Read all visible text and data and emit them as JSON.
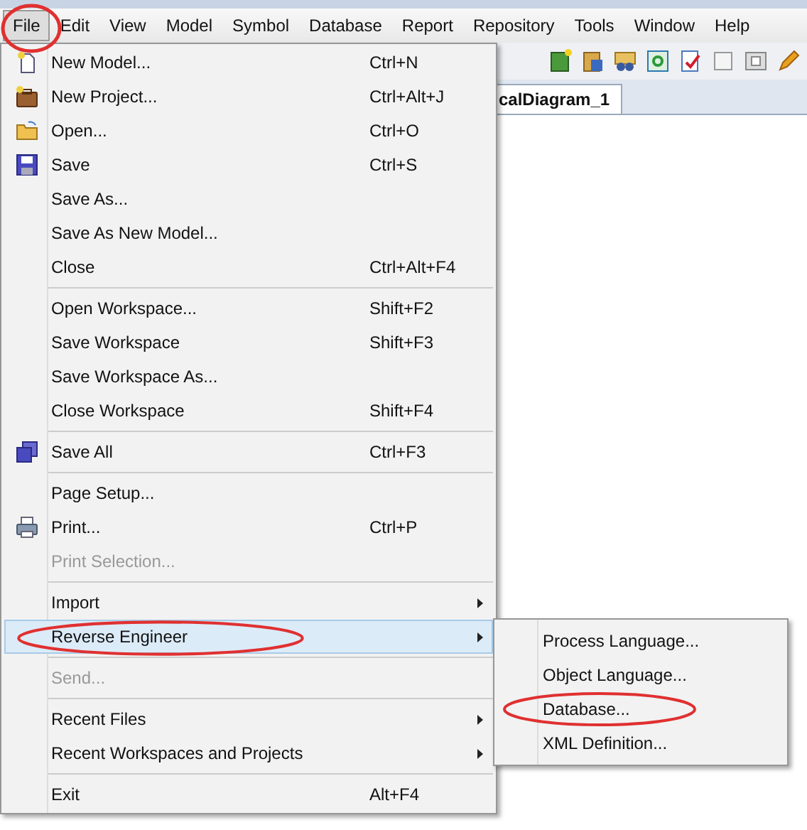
{
  "menubar": [
    {
      "label": "File",
      "selected": true
    },
    {
      "label": "Edit",
      "selected": false
    },
    {
      "label": "View",
      "selected": false
    },
    {
      "label": "Model",
      "selected": false
    },
    {
      "label": "Symbol",
      "selected": false
    },
    {
      "label": "Database",
      "selected": false
    },
    {
      "label": "Report",
      "selected": false
    },
    {
      "label": "Repository",
      "selected": false
    },
    {
      "label": "Tools",
      "selected": false
    },
    {
      "label": "Window",
      "selected": false
    },
    {
      "label": "Help",
      "selected": false
    }
  ],
  "document_tab": {
    "label": "calDiagram_1"
  },
  "file_menu": [
    {
      "kind": "item",
      "label": "New Model...",
      "shortcut": "Ctrl+N",
      "disabled": false,
      "submenu": false,
      "selected": false
    },
    {
      "kind": "item",
      "label": "New Project...",
      "shortcut": "Ctrl+Alt+J",
      "disabled": false,
      "submenu": false,
      "selected": false
    },
    {
      "kind": "item",
      "label": "Open...",
      "shortcut": "Ctrl+O",
      "disabled": false,
      "submenu": false,
      "selected": false
    },
    {
      "kind": "item",
      "label": "Save",
      "shortcut": "Ctrl+S",
      "disabled": false,
      "submenu": false,
      "selected": false
    },
    {
      "kind": "item",
      "label": "Save As...",
      "disabled": false,
      "submenu": false,
      "selected": false
    },
    {
      "kind": "item",
      "label": "Save As New Model...",
      "disabled": false,
      "submenu": false,
      "selected": false
    },
    {
      "kind": "item",
      "label": "Close",
      "shortcut": "Ctrl+Alt+F4",
      "disabled": false,
      "submenu": false,
      "selected": false
    },
    {
      "kind": "separator"
    },
    {
      "kind": "item",
      "label": "Open Workspace...",
      "shortcut": "Shift+F2",
      "disabled": false,
      "submenu": false,
      "selected": false
    },
    {
      "kind": "item",
      "label": "Save Workspace",
      "shortcut": "Shift+F3",
      "disabled": false,
      "submenu": false,
      "selected": false
    },
    {
      "kind": "item",
      "label": "Save Workspace As...",
      "disabled": false,
      "submenu": false,
      "selected": false
    },
    {
      "kind": "item",
      "label": "Close Workspace",
      "shortcut": "Shift+F4",
      "disabled": false,
      "submenu": false,
      "selected": false
    },
    {
      "kind": "separator"
    },
    {
      "kind": "item",
      "label": "Save All",
      "shortcut": "Ctrl+F3",
      "disabled": false,
      "submenu": false,
      "selected": false
    },
    {
      "kind": "separator"
    },
    {
      "kind": "item",
      "label": "Page Setup...",
      "disabled": false,
      "submenu": false,
      "selected": false
    },
    {
      "kind": "item",
      "label": "Print...",
      "shortcut": "Ctrl+P",
      "disabled": false,
      "submenu": false,
      "selected": false
    },
    {
      "kind": "item",
      "label": "Print Selection...",
      "disabled": true,
      "submenu": false,
      "selected": false
    },
    {
      "kind": "separator"
    },
    {
      "kind": "item",
      "label": "Import",
      "disabled": false,
      "submenu": true,
      "selected": false
    },
    {
      "kind": "item",
      "label": "Reverse Engineer",
      "disabled": false,
      "submenu": true,
      "selected": true
    },
    {
      "kind": "separator"
    },
    {
      "kind": "item",
      "label": "Send...",
      "disabled": true,
      "submenu": false,
      "selected": false
    },
    {
      "kind": "separator"
    },
    {
      "kind": "item",
      "label": "Recent Files",
      "disabled": false,
      "submenu": true,
      "selected": false
    },
    {
      "kind": "item",
      "label": "Recent Workspaces and Projects",
      "disabled": false,
      "submenu": true,
      "selected": false
    },
    {
      "kind": "separator"
    },
    {
      "kind": "item",
      "label": "Exit",
      "shortcut": "Alt+F4",
      "disabled": false,
      "submenu": false,
      "selected": false
    }
  ],
  "submenu": [
    {
      "label": "Process Language..."
    },
    {
      "label": "Object Language..."
    },
    {
      "label": "Database..."
    },
    {
      "label": "XML Definition..."
    }
  ]
}
